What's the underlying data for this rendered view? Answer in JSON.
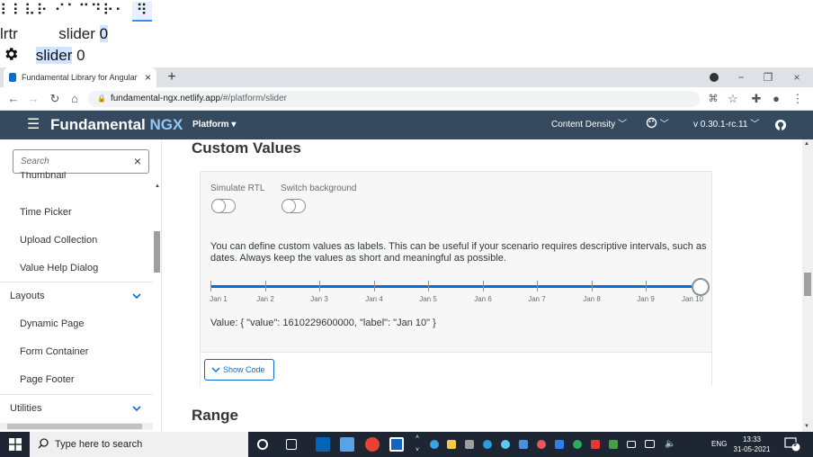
{
  "overlay": {
    "braille_text": "⠇⠇⠧⠗ ⠊⠁⠉⠙⠗⠂",
    "braille_suffix": "⠻",
    "row1_prefix": "lrtr",
    "row1_label": "slider",
    "row1_value": "0",
    "row2_label": "slider",
    "row2_value": "0",
    "row2_icon": "gear-icon"
  },
  "browser": {
    "tab_title": "Fundamental Library for Angular",
    "tab_close": "×",
    "new_tab": "+",
    "url_host": "fundamental-ngx.netlify.app",
    "url_path": "/#/platform/slider",
    "window_minimize": "−",
    "window_restore": "❐",
    "window_close": "×"
  },
  "shell": {
    "menu_icon": "☰",
    "brand_main": "Fundamental",
    "brand_accent": "NGX",
    "product_menu": "Platform ▾",
    "content_density": "Content Density",
    "theme_icon": "palette-icon",
    "version": "v 0.30.1-rc.11",
    "github_icon": "github-icon"
  },
  "sidebar": {
    "search_placeholder": "Search",
    "search_clear": "×",
    "items": [
      {
        "label": "Thumbnail",
        "kind": "item"
      },
      {
        "label": "Time Picker",
        "kind": "item"
      },
      {
        "label": "Upload Collection",
        "kind": "item"
      },
      {
        "label": "Value Help Dialog",
        "kind": "item"
      },
      {
        "label": "Layouts",
        "kind": "group"
      },
      {
        "label": "Dynamic Page",
        "kind": "item"
      },
      {
        "label": "Form Container",
        "kind": "item"
      },
      {
        "label": "Page Footer",
        "kind": "item"
      },
      {
        "label": "Utilities",
        "kind": "group"
      }
    ]
  },
  "main": {
    "section_title": "Custom Values",
    "next_section_title": "Range",
    "toggles": [
      {
        "label": "Simulate RTL",
        "on": false
      },
      {
        "label": "Switch background",
        "on": false
      }
    ],
    "description": "You can define custom values as labels. This can be useful if your scenario requires descriptive intervals, such as dates. Always keep the values as short and meaningful as possible.",
    "slider": {
      "labels": [
        "Jan 1",
        "Jan 2",
        "Jan 3",
        "Jan 4",
        "Jan 5",
        "Jan 6",
        "Jan 7",
        "Jan 8",
        "Jan 9",
        "Jan 10"
      ],
      "selected_index": 9
    },
    "value_text": "Value: { \"value\": 1610229600000, \"label\": \"Jan 10\" }",
    "show_code_label": "Show Code"
  },
  "taskbar": {
    "search_placeholder": "Type here to search",
    "language": "ENG",
    "time": "13:33",
    "date": "31-05-2021",
    "notifications": "9"
  },
  "colors": {
    "shell": "#354a5f",
    "accent": "#0a6ed1",
    "brand_accent": "#91c8f6"
  }
}
